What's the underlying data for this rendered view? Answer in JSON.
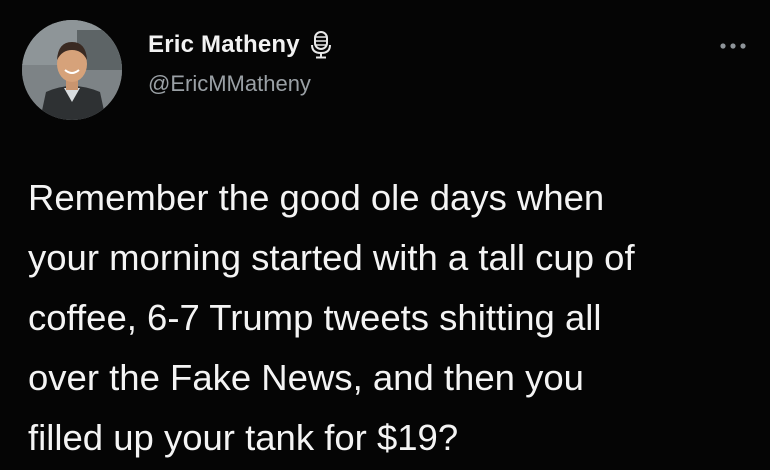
{
  "author": {
    "display_name": "Eric Matheny",
    "handle": "@EricMMatheny",
    "avatar_icon": "profile-photo",
    "badge_icon": "microphone-icon"
  },
  "menu": {
    "icon": "more-options-icon"
  },
  "tweet": {
    "lines": [
      "Remember the good ole days when",
      "your morning started with a tall cup of",
      "coffee, 6-7 Trump tweets shitting all",
      "over the Fake News, and then you",
      "filled up your tank for $19?"
    ]
  },
  "colors": {
    "background": "#050505",
    "text": "#f4f4f4",
    "handle": "#9aa0a5"
  }
}
